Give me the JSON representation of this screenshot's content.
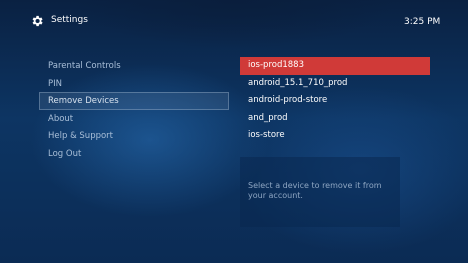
{
  "header": {
    "title": "Settings",
    "clock": "3:25 PM",
    "icon": "gear-icon"
  },
  "menu": {
    "items": [
      {
        "label": "Parental Controls"
      },
      {
        "label": "PIN"
      },
      {
        "label": "Remove Devices",
        "selected": true
      },
      {
        "label": "About"
      },
      {
        "label": "Help & Support"
      },
      {
        "label": "Log Out"
      }
    ]
  },
  "devices": {
    "items": [
      {
        "label": "ios-prod1883",
        "selected": true
      },
      {
        "label": "android_15.1_710_prod"
      },
      {
        "label": "android-prod-store"
      },
      {
        "label": "and_prod"
      },
      {
        "label": "ios-store"
      }
    ],
    "highlight_color": "#d03a38"
  },
  "help": {
    "text": "Select a device to remove it from your account."
  }
}
